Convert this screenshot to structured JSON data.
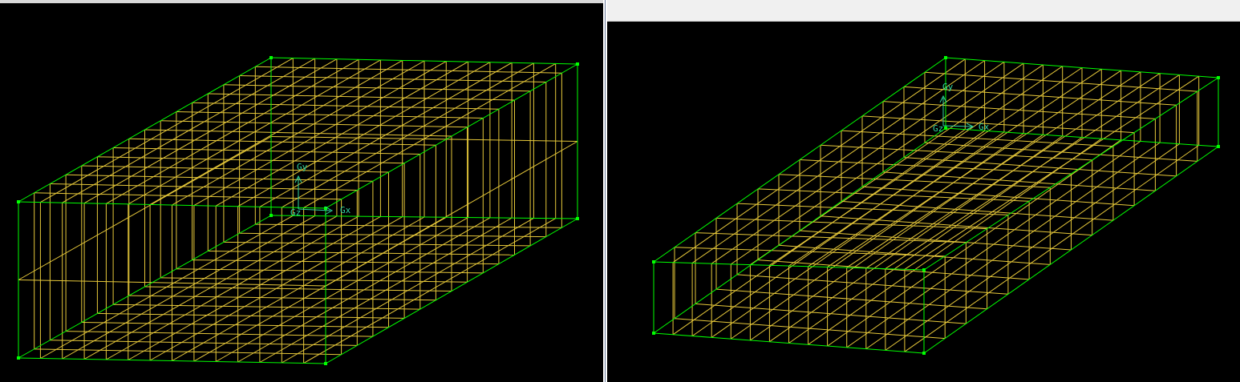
{
  "colors": {
    "background": "#000000",
    "edge": "#00ff00",
    "mesh": "#e6c83a",
    "axis": "#2fd4a0"
  },
  "left_view": {
    "axes": {
      "y": "Gy",
      "z": "Gz",
      "x": "Gx"
    }
  },
  "right_view": {
    "axes": {
      "y": "Gy",
      "z": "Gz",
      "x": "Gx"
    }
  }
}
